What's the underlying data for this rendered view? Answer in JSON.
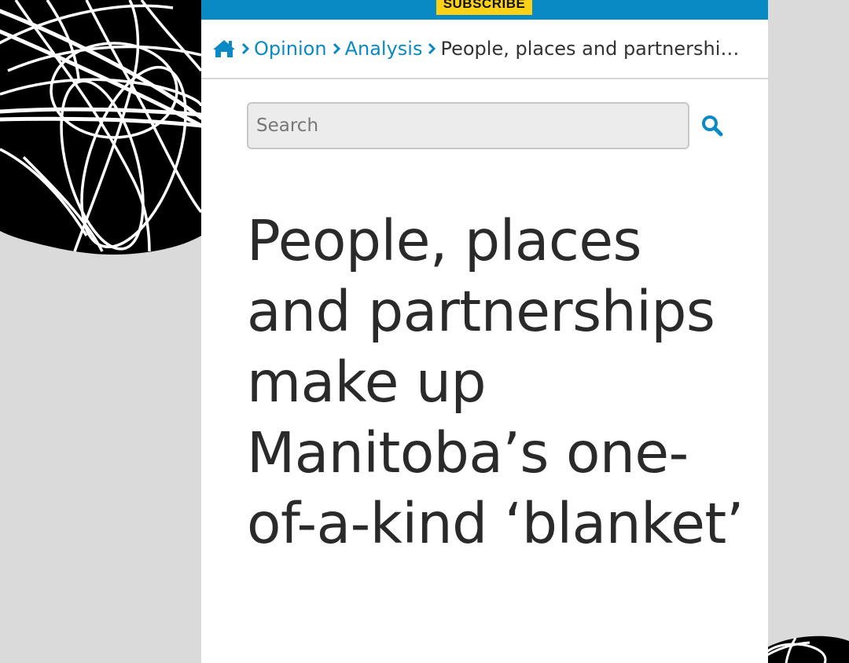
{
  "header": {
    "subscribe_label": "SUBSCRIBE"
  },
  "breadcrumb": {
    "home_icon": "home-icon",
    "separator_icon": "chevron-right-icon",
    "items": [
      {
        "label": "Opinion"
      },
      {
        "label": "Analysis"
      }
    ],
    "current": "People, places and partnershi…"
  },
  "search": {
    "placeholder": "Search",
    "value": "",
    "button_icon": "search-icon"
  },
  "article": {
    "headline": "People, places and partnerships make up Manitoba’s one-of-a-kind ‘blanket’"
  },
  "colors": {
    "brand_blue": "#0a8ac4",
    "subscribe_yellow": "#fcd116",
    "page_gray": "#dadada",
    "headline_text": "#2a2a2a"
  }
}
